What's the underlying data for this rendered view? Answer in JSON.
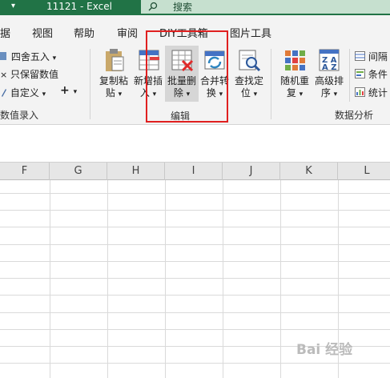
{
  "titlebar": {
    "qat_arrow": "▾",
    "title": "11121  -  Excel",
    "search_placeholder": "搜索"
  },
  "tabs": [
    "据",
    "视图",
    "帮助",
    "审阅",
    "DIY工具箱",
    "图片工具"
  ],
  "ribbon": {
    "numeric_group": {
      "round_label": "四舍五入",
      "keep_values_label": "只保留数值",
      "custom_label": "自定义",
      "plus_label": "+",
      "group_label": "数值录入"
    },
    "edit_group": {
      "copy_paste": [
        "复制粘",
        "贴"
      ],
      "new_insert": [
        "新增插",
        "入"
      ],
      "batch_delete": [
        "批量删",
        "除"
      ],
      "merge_convert": [
        "合并转",
        "换"
      ],
      "find_locate": [
        "查找定",
        "位"
      ],
      "group_label": "编辑"
    },
    "analysis_group": {
      "random_repeat": [
        "随机重",
        "复"
      ],
      "advanced_sort": [
        "高级排",
        "序"
      ],
      "interval_label": "间隔",
      "condition_label": "条件",
      "stats_label": "统计",
      "group_label": "数据分析"
    }
  },
  "columns": [
    "F",
    "G",
    "H",
    "I",
    "J",
    "K",
    "L"
  ],
  "watermark": "Bai 经验",
  "colors": {
    "title_green": "#217346",
    "search_bg": "#c6e0cf",
    "highlight_box": "#e02020"
  }
}
